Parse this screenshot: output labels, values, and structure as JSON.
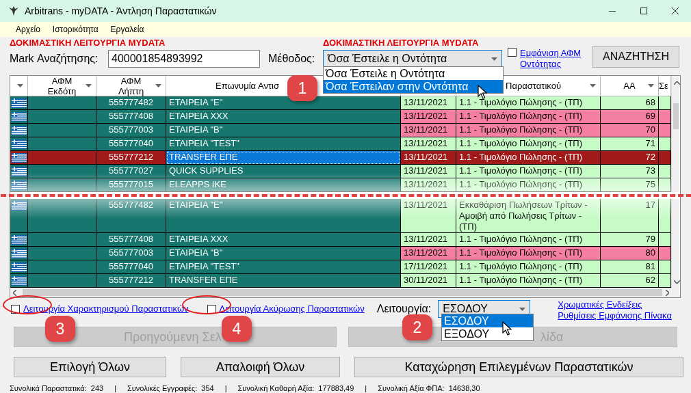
{
  "window": {
    "title": "Arbitrans - myDATA - Άντληση Παραστατικών"
  },
  "menu": [
    "Αρχείο",
    "Ιστορικότητα",
    "Εργαλεία"
  ],
  "search": {
    "warning_left": "ΔΟΚΙΜΑΣΤΙΚΗ ΛΕΙΤΟΥΡΓΙΑ MYDATA",
    "mark_label": "Mark Αναζήτησης:",
    "mark_value": "400001854893992",
    "method_label": "Μέθοδος:",
    "warning_right": "ΔΟΚΙΜΑΣΤΙΚΗ ΛΕΙΤΟΥΡΓΙΑ MYDATA",
    "method_value": "Όσα Έστειλε η Οντότητα",
    "method_expanded": true,
    "method_options": [
      {
        "label": "Όσα Έστειλε η Οντότητα",
        "selected": false
      },
      {
        "label": "Όσα Έστειλαν στην Οντότητα",
        "selected": true
      }
    ],
    "show_afm": {
      "label": "Εμφάνιση ΑΦΜ Οντότητας",
      "checked": false
    },
    "search_button": "ΑΝΑΖΗΤΗΣΗ"
  },
  "table": {
    "headers": {
      "issuer": "ΑΦΜ Εκδότη",
      "receiver": "ΑΦΜ Λήπτη",
      "name": "Επωνυμία Αντισ",
      "type": "Παραστατικού",
      "aa": "ΑΑ",
      "column_9": "Σε"
    },
    "rows_top": [
      {
        "receiver": "555777482",
        "name": "ΕΤΑΙΡΕΙΑ \"Ε\"",
        "date": "13/11/2021",
        "type": "1.1 - Τιμολόγιο Πώλησης - (ΤΠ)",
        "aa": "68",
        "color": "#c6fbc6",
        "selected": false
      },
      {
        "receiver": "555777408",
        "name": "ΕΤΑΙΡΕΙΑ XXX",
        "date": "13/11/2021",
        "type": "1.1 - Τιμολόγιο Πώλησης - (ΤΠ)",
        "aa": "69",
        "color": "#f47fa1",
        "selected": false
      },
      {
        "receiver": "555777003",
        "name": "ΕΤΑΙΡΕΙΑ \"B\"",
        "date": "13/11/2021",
        "type": "1.1 - Τιμολόγιο Πώλησης - (ΤΠ)",
        "aa": "70",
        "color": "#f47fa1",
        "selected": false
      },
      {
        "receiver": "555777040",
        "name": "ΕΤΑΙΡΕΙΑ \"TEST\"",
        "date": "13/11/2021",
        "type": "1.1 - Τιμολόγιο Πώλησης - (ΤΠ)",
        "aa": "71",
        "color": "#c6fbc6",
        "selected": false
      },
      {
        "receiver": "555777212",
        "name": "TRANSFER ΕΠΕ",
        "date": "13/11/2021",
        "type": "1.1 - Τιμολόγιο Πώλησης - (ΤΠ)",
        "aa": "72",
        "color": "#a01a1a",
        "selected": true
      },
      {
        "receiver": "555777027",
        "name": "QUICK SUPPLIES",
        "date": "13/11/2021",
        "type": "1.1 - Τιμολόγιο Πώλησης - (ΤΠ)",
        "aa": "73",
        "color": "#c6fbc6",
        "selected": false
      },
      {
        "receiver": "555777015",
        "name": "ELEAPPS IKE",
        "date": "13/11/2021",
        "type": "1.1 - Τιμολόγιο Πώλησης - (ΤΠ)",
        "aa": "75",
        "color": "#c6fbc6",
        "selected": false
      }
    ],
    "rows_bottom": [
      {
        "receiver": "555777482",
        "name": "ΕΤΑΙΡΕΙΑ \"Ε\"",
        "date": "13/11/2021",
        "type": "Εκκαθάριση Πωλήσεων Τρίτων - Αμοιβή από Πωλήσεις Τρίτων - (ΤΠ)",
        "aa": "17",
        "color": "#c6fbc6",
        "selected": false
      },
      {
        "receiver": "555777408",
        "name": "ΕΤΑΙΡΕΙΑ XXX",
        "date": "13/11/2021",
        "type": "1.1 - Τιμολόγιο Πώλησης - (ΤΠ)",
        "aa": "79",
        "color": "#c6fbc6",
        "selected": false
      },
      {
        "receiver": "555777003",
        "name": "ΕΤΑΙΡΕΙΑ \"B\"",
        "date": "13/11/2021",
        "type": "1.1 - Τιμολόγιο Πώλησης - (ΤΠ)",
        "aa": "80",
        "color": "#f47fa1",
        "selected": false
      },
      {
        "receiver": "555777040",
        "name": "ΕΤΑΙΡΕΙΑ \"TEST\"",
        "date": "17/11/2021",
        "type": "1.1 - Τιμολόγιο Πώλησης - (ΤΠ)",
        "aa": "81",
        "color": "#c6fbc6",
        "selected": false
      },
      {
        "receiver": "555777212",
        "name": "TRANSFER ΕΠΕ",
        "date": "30/11/2021",
        "type": "1.1 - Τιμολόγιο Πώλησης - (ΤΠ)",
        "aa": "62",
        "color": "#c6fbc6",
        "selected": false
      }
    ]
  },
  "options": {
    "characterize": {
      "label": "Λειτουργία Χαρακτηρισμού Παραστατικών",
      "checked": false
    },
    "cancel": {
      "label": "Λειτουργία Ακύρωσης Παραστατικών",
      "checked": false
    },
    "mode_label": "Λειτουργία:",
    "mode_value": "ΕΣΟΔΟΥ",
    "mode_expanded": true,
    "mode_options": [
      {
        "label": "ΕΣΟΔΟΥ",
        "selected": true
      },
      {
        "label": "ΕΞΟΔΟΥ",
        "selected": false
      }
    ],
    "links": [
      "Χρωματικές Ενδείξεις",
      "Ρυθμίσεις Εμφάνισης Πίνακα"
    ]
  },
  "paging": [
    {
      "label": "Προηγούμενη Σελ",
      "disabled": true
    },
    {
      "label": "λίδα",
      "disabled": true
    }
  ],
  "actions": [
    "Επιλογή Όλων",
    "Απαλοιφή Όλων",
    "Καταχώρηση Επιλεγμένων Παραστατικών"
  ],
  "status_bar": [
    {
      "kind": "field",
      "label": "Συνολικά Παραστατικά:",
      "value": "243"
    },
    {
      "kind": "separator",
      "text": "|"
    },
    {
      "kind": "field",
      "label": "Συνολικές Εγγραφές:",
      "value": "354"
    },
    {
      "kind": "separator",
      "text": "|"
    },
    {
      "kind": "field",
      "label": "Συνολική Καθαρή Αξία:",
      "value": "177883,49"
    },
    {
      "kind": "separator",
      "text": "|"
    },
    {
      "kind": "field",
      "label": "Συνολική Αξία ΦΠΑ:",
      "value": "14638,30"
    }
  ],
  "callouts": [
    {
      "label": "1"
    },
    {
      "label": "3"
    },
    {
      "label": "4"
    },
    {
      "label": "2"
    }
  ]
}
